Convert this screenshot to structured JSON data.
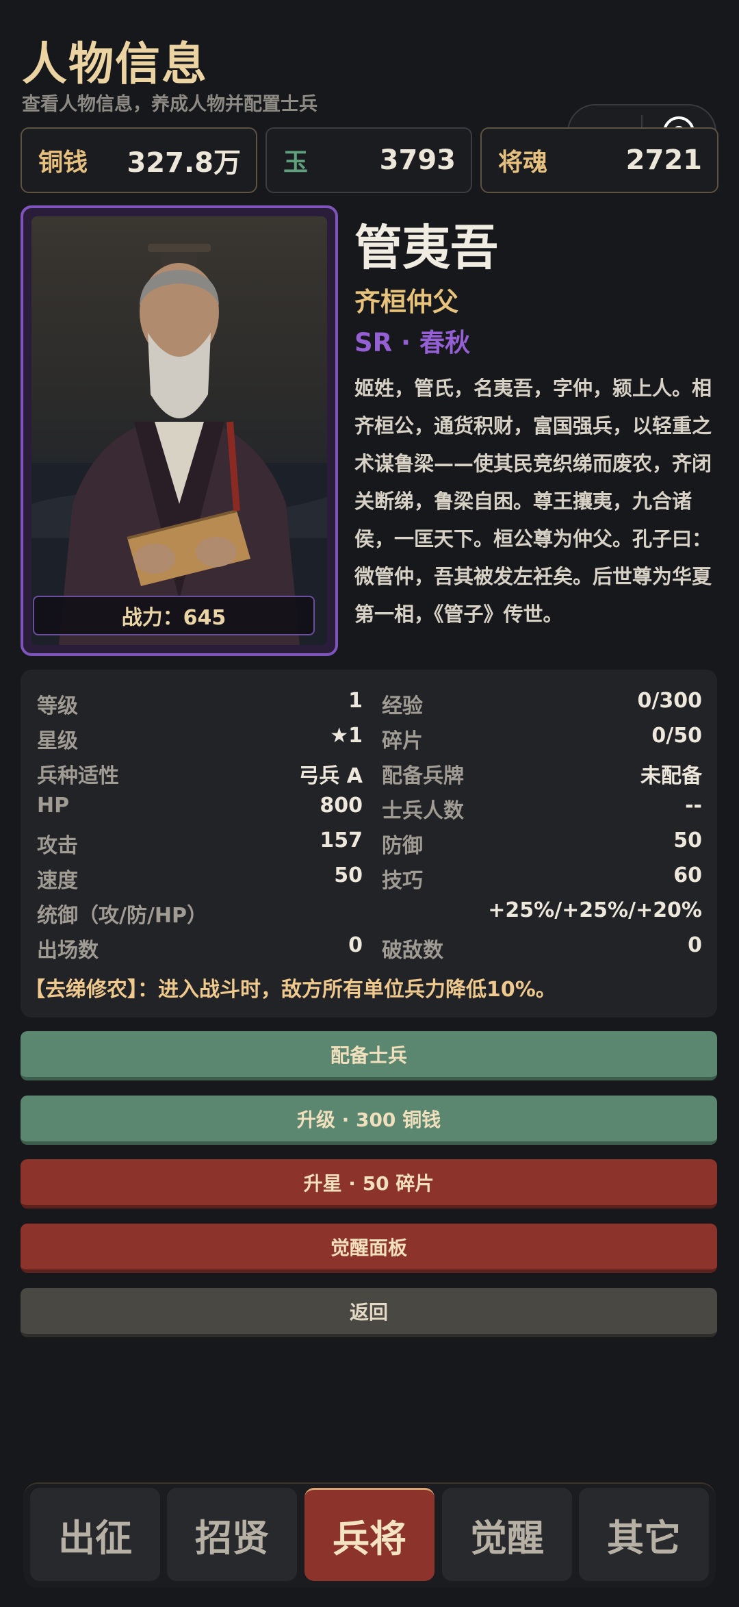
{
  "header": {
    "title": "人物信息",
    "subtitle": "查看人物信息，养成人物并配置士兵"
  },
  "capsule": {
    "more_icon": "more-dots-icon",
    "close_icon": "target-circle-icon"
  },
  "currencies": [
    {
      "label": "铜钱",
      "value": "327.8万",
      "color": "#e5c07f"
    },
    {
      "label": "玉",
      "value": "3793",
      "color": "#5fa07d"
    },
    {
      "label": "将魂",
      "value": "2721",
      "color": "#e5c07f"
    }
  ],
  "hero": {
    "name": "管夷吾",
    "title": "齐桓仲父",
    "rarity": "SR · 春秋",
    "rarity_color": "#9460d4",
    "power": "战力：645",
    "bio": "姬姓，管氏，名夷吾，字仲，颍上人。相齐桓公，通货积财，富国强兵，以轻重之术谋鲁梁——使其民竞织绨而废农，齐闭关断绨，鲁梁自困。尊王攘夷，九合诸侯，一匡天下。桓公尊为仲父。孔子曰：微管仲，吾其被发左衽矣。后世尊为华夏第一相，《管子》传世。"
  },
  "stats": [
    {
      "k1": "等级",
      "v1": "1",
      "k2": "经验",
      "v2": "0/300"
    },
    {
      "k1": "星级",
      "v1": "★1",
      "k2": "碎片",
      "v2": "0/50"
    },
    {
      "k1": "兵种适性",
      "v1": "弓兵 A",
      "k2": "配备兵牌",
      "v2": "未配备"
    },
    {
      "k1": "HP",
      "v1": "800",
      "k2": "士兵人数",
      "v2": "--"
    },
    {
      "k1": "攻击",
      "v1": "157",
      "k2": "防御",
      "v2": "50"
    },
    {
      "k1": "速度",
      "v1": "50",
      "k2": "技巧",
      "v2": "60"
    },
    {
      "k1": "统御（攻/防/HP）",
      "v1": "",
      "k2": "",
      "v2": "+25%/+25%/+20%"
    },
    {
      "k1": "出场数",
      "v1": "0",
      "k2": "破敌数",
      "v2": "0"
    }
  ],
  "skill": "【去绨修农】：进入战斗时，敌方所有单位兵力降低10%。",
  "buttons": {
    "equip": "配备士兵",
    "level_up": "升级 · 300 铜钱",
    "star_up": "升星 · 50 碎片",
    "awaken": "觉醒面板",
    "back": "返回"
  },
  "tabs": [
    {
      "label": "出征",
      "active": false
    },
    {
      "label": "招贤",
      "active": false
    },
    {
      "label": "兵将",
      "active": true
    },
    {
      "label": "觉醒",
      "active": false
    },
    {
      "label": "其它",
      "active": false
    }
  ]
}
